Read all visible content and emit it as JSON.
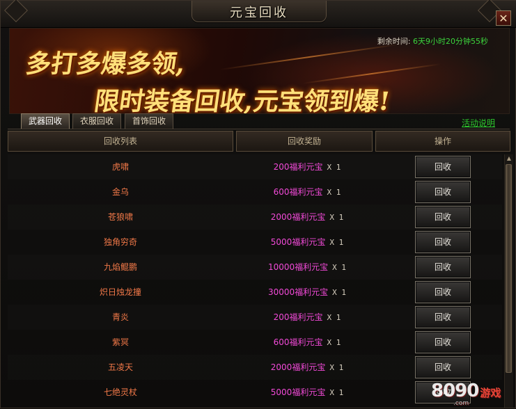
{
  "window": {
    "title": "元宝回收",
    "close_label": "✕"
  },
  "banner": {
    "countdown_label": "剩余时间:",
    "countdown_value": "6天9小时20分钟55秒",
    "slogan_line1": "多打多爆多领,",
    "slogan_line2": "限时装备回收,元宝领到爆!"
  },
  "tabs": [
    {
      "label": "武器回收",
      "active": true
    },
    {
      "label": "衣服回收",
      "active": false
    },
    {
      "label": "首饰回收",
      "active": false
    }
  ],
  "help_link": "活动说明",
  "table": {
    "headers": [
      "回收列表",
      "回收奖励",
      "操作"
    ],
    "button_label": "回收",
    "rows": [
      {
        "name": "虎啸",
        "reward": "200福利元宝",
        "mult": "X 1"
      },
      {
        "name": "金乌",
        "reward": "600福利元宝",
        "mult": "X 1"
      },
      {
        "name": "苍狼啸",
        "reward": "2000福利元宝",
        "mult": "X 1"
      },
      {
        "name": "独角穷奇",
        "reward": "5000福利元宝",
        "mult": "X 1"
      },
      {
        "name": "九焰鲲鹏",
        "reward": "10000福利元宝",
        "mult": "X 1"
      },
      {
        "name": "炽日烛龙撞",
        "reward": "30000福利元宝",
        "mult": "X 1"
      },
      {
        "name": "青炎",
        "reward": "200福利元宝",
        "mult": "X 1"
      },
      {
        "name": "紫冥",
        "reward": "600福利元宝",
        "mult": "X 1"
      },
      {
        "name": "五凌天",
        "reward": "2000福利元宝",
        "mult": "X 1"
      },
      {
        "name": "七绝灵杖",
        "reward": "5000福利元宝",
        "mult": "X 1"
      }
    ]
  },
  "watermark": {
    "brand": "8090",
    "brand_cn": "游戏",
    "url": ".com"
  },
  "colors": {
    "item_name": "#f07848",
    "reward": "#f24ad8",
    "countdown": "#3cd43c",
    "help_link": "#2ec82e"
  }
}
